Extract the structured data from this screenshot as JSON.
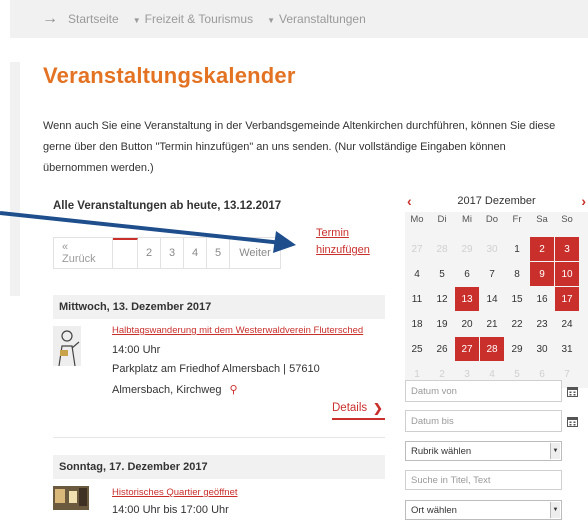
{
  "breadcrumb": {
    "items": [
      "Startseite",
      "Freizeit & Tourismus",
      "Veranstaltungen"
    ]
  },
  "page": {
    "title": "Veranstaltungskalender",
    "intro_line1": "Wenn auch Sie eine Veranstaltung in der Verbandsgemeinde Altenkirchen durchführen, können Sie diese",
    "intro_line2": "gerne über den Button \"Termin hinzufügen\" an uns senden. (Nur vollständige Eingaben können",
    "intro_line3": "übernommen werden.)"
  },
  "list": {
    "heading": "Alle Veranstaltungen ab heute, 13.12.2017",
    "termin_line1": "Termin",
    "termin_line2": "hinzufügen"
  },
  "pager": {
    "prev": "« Zurück",
    "pages": [
      "2",
      "3",
      "4",
      "5"
    ],
    "next": "Weiter"
  },
  "calendar": {
    "title": "2017 Dezember",
    "prev": "‹",
    "next": "›",
    "weekdays": [
      "Mo",
      "Di",
      "Mi",
      "Do",
      "Fr",
      "Sa",
      "So"
    ],
    "weeks": [
      [
        {
          "d": "27",
          "s": "muted"
        },
        {
          "d": "28",
          "s": "muted"
        },
        {
          "d": "29",
          "s": "muted"
        },
        {
          "d": "30",
          "s": "muted"
        },
        {
          "d": "1",
          "s": ""
        },
        {
          "d": "2",
          "s": "event"
        },
        {
          "d": "3",
          "s": "event"
        }
      ],
      [
        {
          "d": "4",
          "s": ""
        },
        {
          "d": "5",
          "s": ""
        },
        {
          "d": "6",
          "s": ""
        },
        {
          "d": "7",
          "s": ""
        },
        {
          "d": "8",
          "s": ""
        },
        {
          "d": "9",
          "s": "event"
        },
        {
          "d": "10",
          "s": "event"
        }
      ],
      [
        {
          "d": "11",
          "s": ""
        },
        {
          "d": "12",
          "s": ""
        },
        {
          "d": "13",
          "s": "today"
        },
        {
          "d": "14",
          "s": ""
        },
        {
          "d": "15",
          "s": ""
        },
        {
          "d": "16",
          "s": ""
        },
        {
          "d": "17",
          "s": "event"
        }
      ],
      [
        {
          "d": "18",
          "s": ""
        },
        {
          "d": "19",
          "s": ""
        },
        {
          "d": "20",
          "s": ""
        },
        {
          "d": "21",
          "s": ""
        },
        {
          "d": "22",
          "s": ""
        },
        {
          "d": "23",
          "s": ""
        },
        {
          "d": "24",
          "s": ""
        }
      ],
      [
        {
          "d": "25",
          "s": ""
        },
        {
          "d": "26",
          "s": ""
        },
        {
          "d": "27",
          "s": "event"
        },
        {
          "d": "28",
          "s": "event"
        },
        {
          "d": "29",
          "s": ""
        },
        {
          "d": "30",
          "s": ""
        },
        {
          "d": "31",
          "s": ""
        }
      ],
      [
        {
          "d": "1",
          "s": "muted"
        },
        {
          "d": "2",
          "s": "muted"
        },
        {
          "d": "3",
          "s": "muted"
        },
        {
          "d": "4",
          "s": "muted"
        },
        {
          "d": "5",
          "s": "muted"
        },
        {
          "d": "6",
          "s": "muted"
        },
        {
          "d": "7",
          "s": "muted"
        }
      ]
    ]
  },
  "filters": {
    "date_from_placeholder": "Datum von",
    "date_to_placeholder": "Datum bis",
    "rubrik": "Rubrik wählen",
    "search_placeholder": "Suche in Titel, Text",
    "ort": "Ort wählen"
  },
  "events": [
    {
      "day": "Mittwoch, 13. Dezember 2017",
      "title": "Halbtagswanderung mit dem Westerwaldverein Flutersched",
      "time": "14:00 Uhr",
      "place": "Parkplatz am Friedhof Almersbach | 57610",
      "address": "Almersbach, Kirchweg",
      "details": "Details"
    },
    {
      "day": "Sonntag, 17. Dezember 2017",
      "title": "Historisches Quartier geöffnet",
      "time": "14:00 Uhr bis 17:00 Uhr"
    }
  ],
  "colors": {
    "accent": "#e37222",
    "red": "#c9302c",
    "arrow": "#1f4e8c"
  },
  "icons": [
    "arrow-right-icon",
    "calendar-icon",
    "map-pin-icon",
    "chevron-right-icon",
    "dropdown-icon"
  ]
}
